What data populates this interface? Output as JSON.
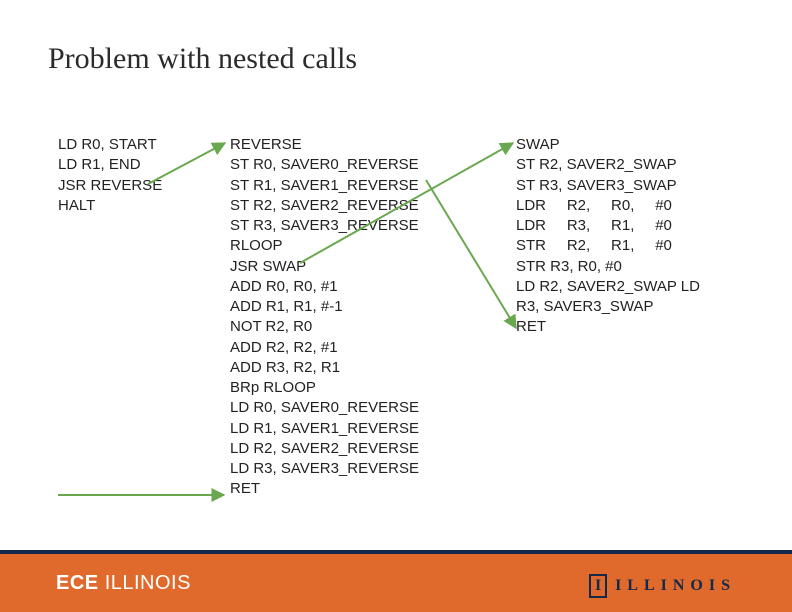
{
  "title": "Problem with nested calls",
  "col1": "LD R0, START\nLD R1, END\nJSR REVERSE\nHALT",
  "col2": "REVERSE\nST R0, SAVER0_REVERSE\nST R1, SAVER1_REVERSE\nST R2, SAVER2_REVERSE\nST R3, SAVER3_REVERSE\nRLOOP\nJSR SWAP\nADD R0, R0, #1\nADD R1, R1, #-1\nNOT R2, R0\nADD R2, R2, #1\nADD R3, R2, R1\nBRp RLOOP\nLD R0, SAVER0_REVERSE\nLD R1, SAVER1_REVERSE\nLD R2, SAVER2_REVERSE\nLD R3, SAVER3_REVERSE\nRET",
  "col3": "SWAP\nST R2, SAVER2_SWAP\nST R3, SAVER3_SWAP\nLDR     R2,     R0,     #0\nLDR     R3,     R1,     #0\nSTR     R2,     R1,     #0\nSTR R3, R0, #0\nLD R2, SAVER2_SWAP LD\nR3, SAVER3_SWAP\nRET",
  "footer": {
    "ece": "ECE",
    "illinois": "ILLINOIS",
    "logoText": "ILLINOIS"
  },
  "colors": {
    "orange": "#e06a2b",
    "navy": "#13294b",
    "arrowGreen": "#6aa84f"
  }
}
